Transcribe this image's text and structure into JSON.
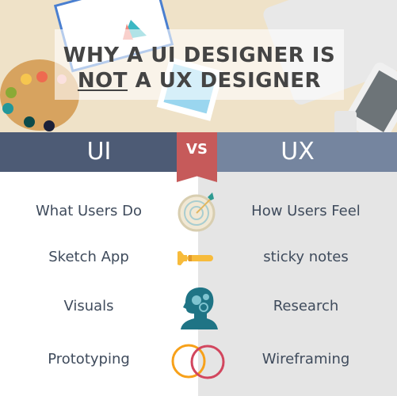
{
  "title": {
    "line1": "WHY A UI DESIGNER IS",
    "line2_pre": "",
    "line2_underlined": "NOT",
    "line2_post": " A UX DESIGNER"
  },
  "header": {
    "left": "UI",
    "vs": "VS",
    "right": "UX"
  },
  "rows": [
    {
      "left": "What Users Do",
      "icon": "target-icon",
      "right": "How Users Feel"
    },
    {
      "left": "Sketch App",
      "icon": "wrench-icon",
      "right": "sticky notes"
    },
    {
      "left": "Visuals",
      "icon": "head-gears-icon",
      "right": "Research"
    },
    {
      "left": "Prototyping",
      "icon": "overlapping-circles-icon",
      "right": "Wireframing"
    }
  ],
  "colors": {
    "ui": "#4d5b75",
    "ux": "#75859f",
    "vs": "#c65a5a"
  }
}
